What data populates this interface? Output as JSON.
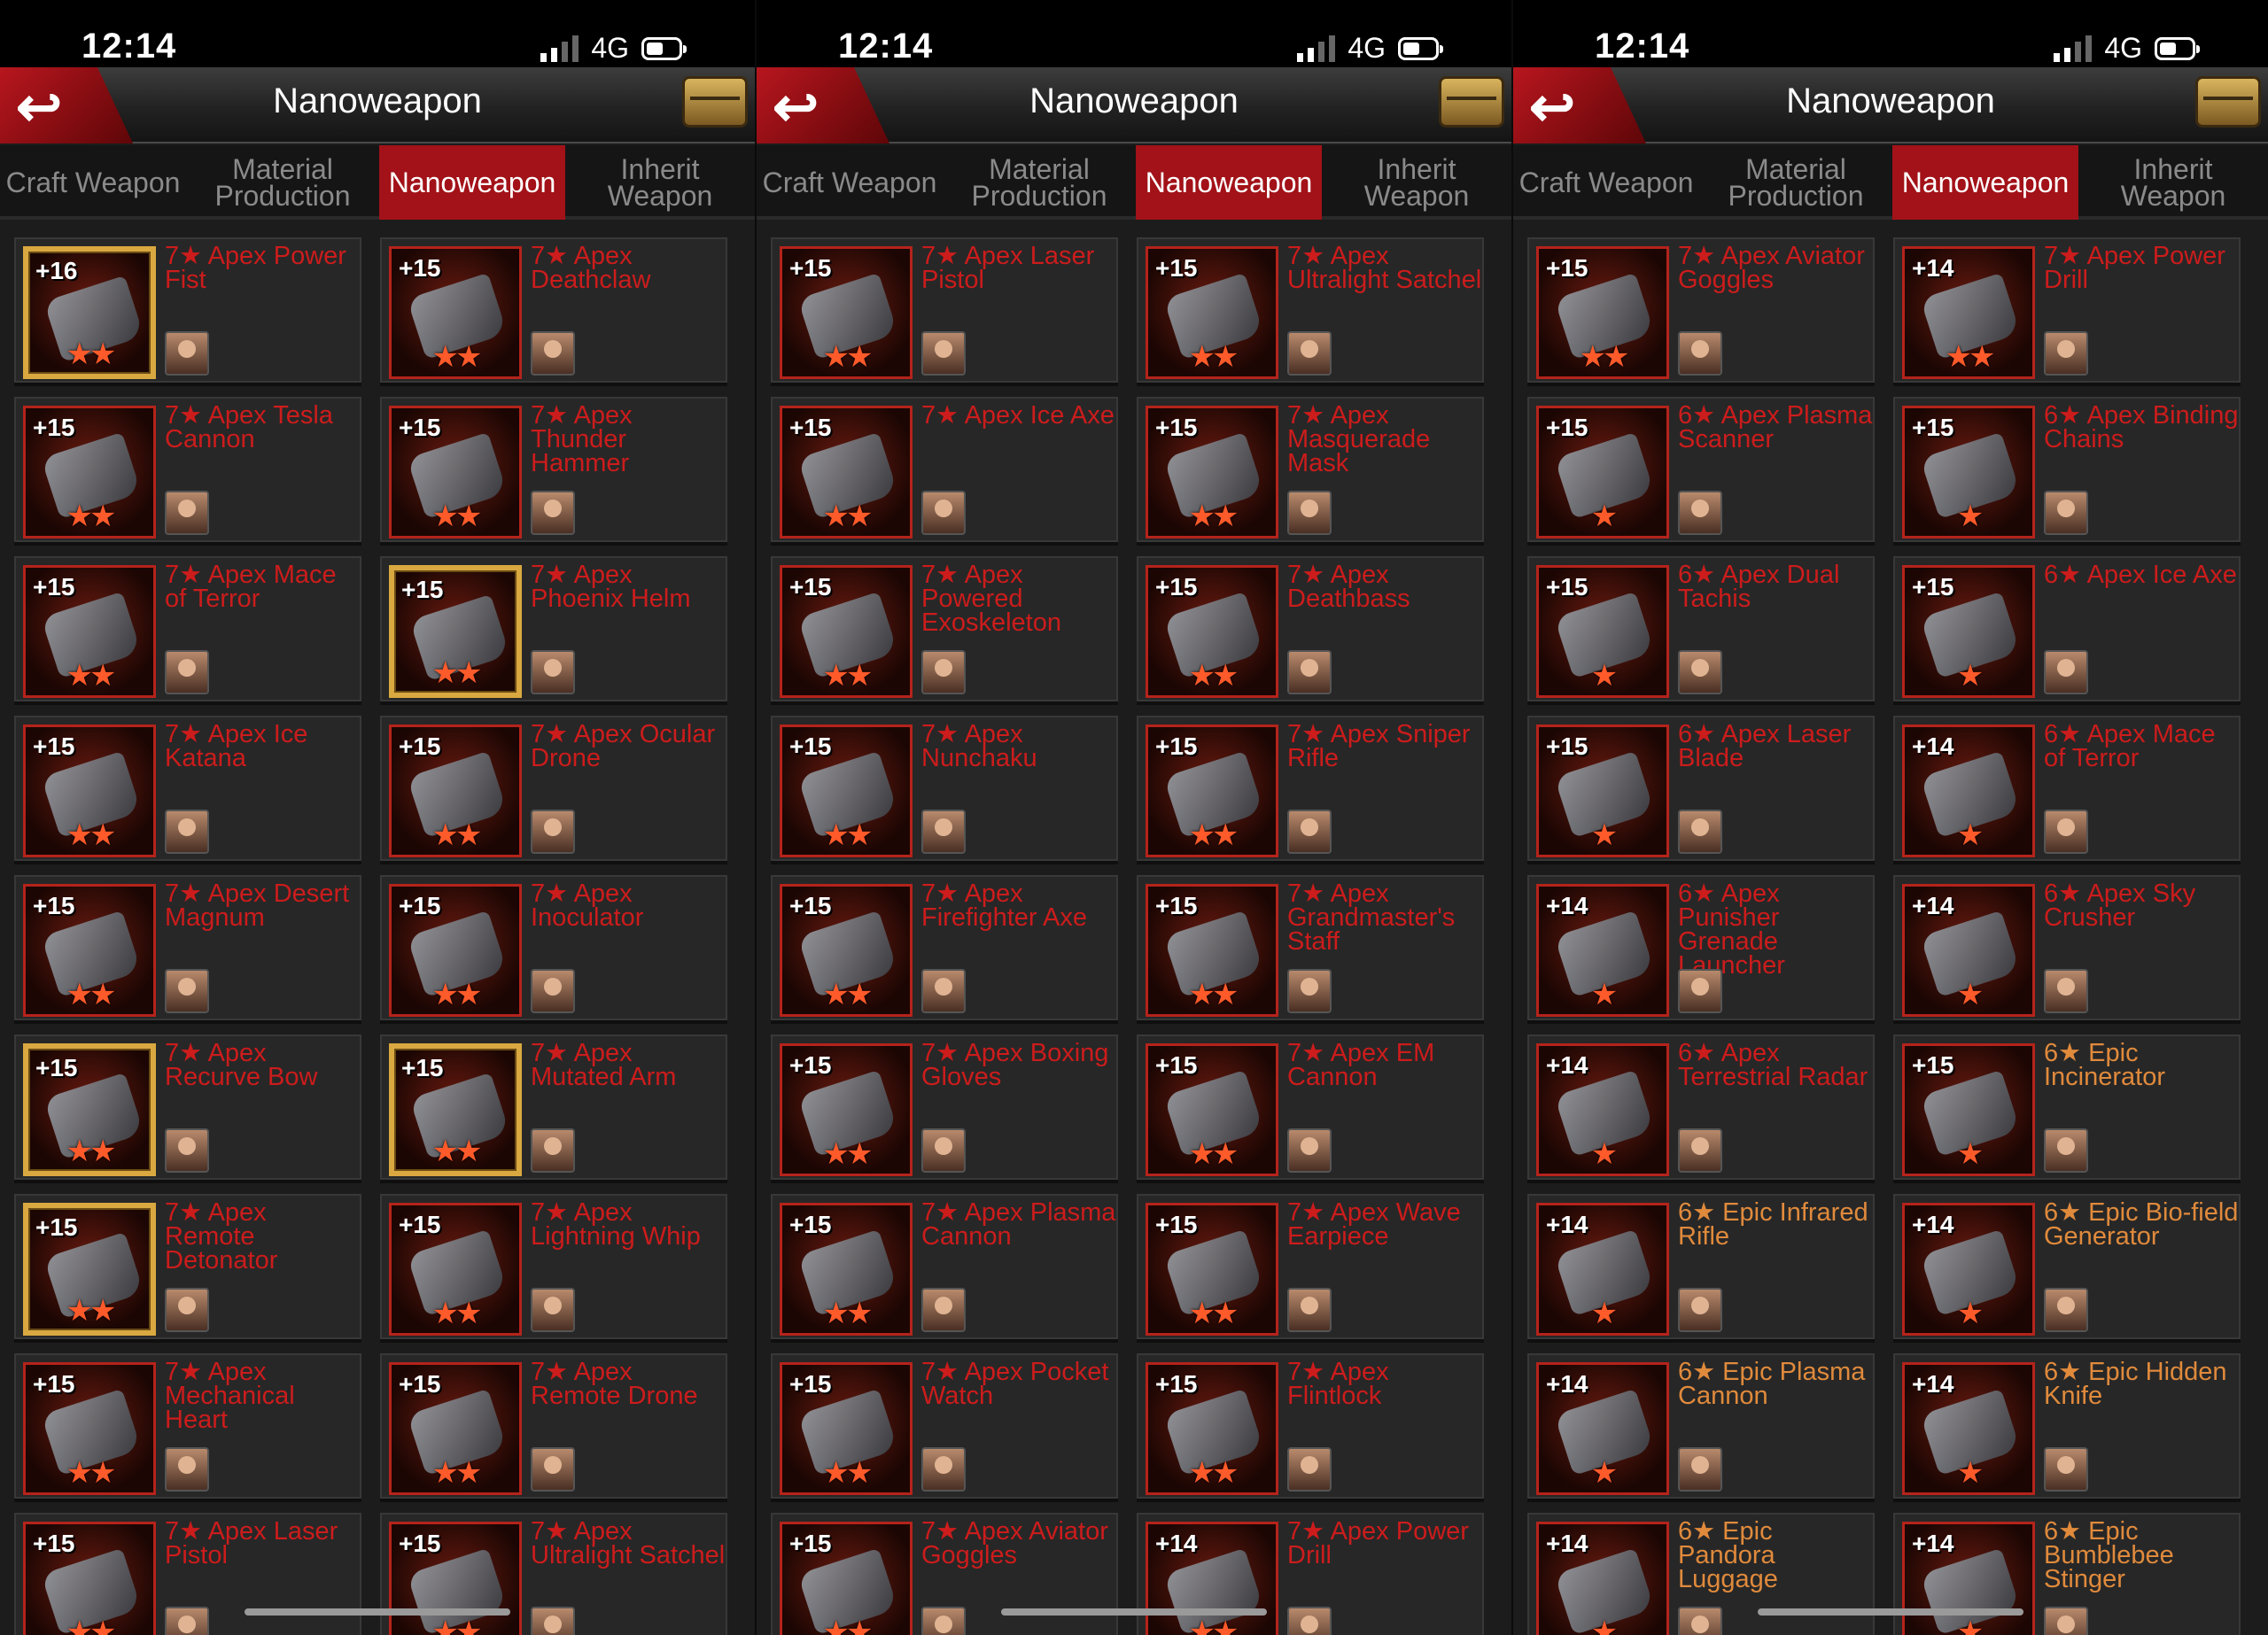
{
  "panels": [
    {
      "status": {
        "time": "12:14",
        "network": "4G"
      },
      "title": "Nanoweapon",
      "tabs": [
        "Craft Weapon",
        "Material Production",
        "Nanoweapon",
        "Inherit Weapon"
      ],
      "active_tab": 2,
      "items": [
        {
          "level": "+16",
          "name": "7★ Apex Power Fist",
          "stars": "★★",
          "gold": true
        },
        {
          "level": "+15",
          "name": "7★ Apex Deathclaw",
          "stars": "★★",
          "gold": false
        },
        {
          "level": "+15",
          "name": "7★ Apex Tesla Cannon",
          "stars": "★★",
          "gold": false
        },
        {
          "level": "+15",
          "name": "7★ Apex Thunder Hammer",
          "stars": "★★",
          "gold": false
        },
        {
          "level": "+15",
          "name": "7★ Apex Mace of Terror",
          "stars": "★★",
          "gold": false
        },
        {
          "level": "+15",
          "name": "7★ Apex Phoenix Helm",
          "stars": "★★",
          "gold": true
        },
        {
          "level": "+15",
          "name": "7★ Apex Ice Katana",
          "stars": "★★",
          "gold": false
        },
        {
          "level": "+15",
          "name": "7★ Apex Ocular Drone",
          "stars": "★★",
          "gold": false
        },
        {
          "level": "+15",
          "name": "7★ Apex Desert Magnum",
          "stars": "★★",
          "gold": false
        },
        {
          "level": "+15",
          "name": "7★ Apex Inoculator",
          "stars": "★★",
          "gold": false
        },
        {
          "level": "+15",
          "name": "7★ Apex Recurve Bow",
          "stars": "★★",
          "gold": true
        },
        {
          "level": "+15",
          "name": "7★ Apex Mutated Arm",
          "stars": "★★",
          "gold": true
        },
        {
          "level": "+15",
          "name": "7★ Apex Remote Detonator",
          "stars": "★★",
          "gold": true
        },
        {
          "level": "+15",
          "name": "7★ Apex Lightning Whip",
          "stars": "★★",
          "gold": false
        },
        {
          "level": "+15",
          "name": "7★ Apex Mechanical Heart",
          "stars": "★★",
          "gold": false
        },
        {
          "level": "+15",
          "name": "7★ Apex Remote Drone",
          "stars": "★★",
          "gold": false
        },
        {
          "level": "+15",
          "name": "7★ Apex Laser Pistol",
          "stars": "★★",
          "gold": false
        },
        {
          "level": "+15",
          "name": "7★ Apex Ultralight Satchel",
          "stars": "★★",
          "gold": false
        }
      ]
    },
    {
      "status": {
        "time": "12:14",
        "network": "4G"
      },
      "title": "Nanoweapon",
      "tabs": [
        "Craft Weapon",
        "Material Production",
        "Nanoweapon",
        "Inherit Weapon"
      ],
      "active_tab": 2,
      "items": [
        {
          "level": "+15",
          "name": "7★ Apex Laser Pistol",
          "stars": "★★",
          "gold": false
        },
        {
          "level": "+15",
          "name": "7★ Apex Ultralight Satchel",
          "stars": "★★",
          "gold": false
        },
        {
          "level": "+15",
          "name": "7★ Apex Ice Axe",
          "stars": "★★",
          "gold": false
        },
        {
          "level": "+15",
          "name": "7★ Apex Masquerade Mask",
          "stars": "★★",
          "gold": false
        },
        {
          "level": "+15",
          "name": "7★ Apex Powered Exoskeleton",
          "stars": "★★",
          "gold": false
        },
        {
          "level": "+15",
          "name": "7★ Apex Deathbass",
          "stars": "★★",
          "gold": false
        },
        {
          "level": "+15",
          "name": "7★ Apex Nunchaku",
          "stars": "★★",
          "gold": false
        },
        {
          "level": "+15",
          "name": "7★ Apex Sniper Rifle",
          "stars": "★★",
          "gold": false
        },
        {
          "level": "+15",
          "name": "7★ Apex Firefighter Axe",
          "stars": "★★",
          "gold": false
        },
        {
          "level": "+15",
          "name": "7★ Apex Grandmaster's Staff",
          "stars": "★★",
          "gold": false
        },
        {
          "level": "+15",
          "name": "7★ Apex Boxing Gloves",
          "stars": "★★",
          "gold": false
        },
        {
          "level": "+15",
          "name": "7★ Apex EM Cannon",
          "stars": "★★",
          "gold": false
        },
        {
          "level": "+15",
          "name": "7★ Apex Plasma Cannon",
          "stars": "★★",
          "gold": false
        },
        {
          "level": "+15",
          "name": "7★ Apex Wave Earpiece",
          "stars": "★★",
          "gold": false
        },
        {
          "level": "+15",
          "name": "7★ Apex Pocket Watch",
          "stars": "★★",
          "gold": false
        },
        {
          "level": "+15",
          "name": "7★ Apex Flintlock",
          "stars": "★★",
          "gold": false
        },
        {
          "level": "+15",
          "name": "7★ Apex Aviator Goggles",
          "stars": "★★",
          "gold": false
        },
        {
          "level": "+14",
          "name": "7★ Apex Power Drill",
          "stars": "★★",
          "gold": false
        }
      ]
    },
    {
      "status": {
        "time": "12:14",
        "network": "4G"
      },
      "title": "Nanoweapon",
      "tabs": [
        "Craft Weapon",
        "Material Production",
        "Nanoweapon",
        "Inherit Weapon"
      ],
      "active_tab": 2,
      "items": [
        {
          "level": "+15",
          "name": "7★ Apex Aviator Goggles",
          "stars": "★★",
          "gold": false
        },
        {
          "level": "+14",
          "name": "7★ Apex Power Drill",
          "stars": "★★",
          "gold": false
        },
        {
          "level": "+15",
          "name": "6★ Apex Plasma Scanner",
          "stars": "★",
          "gold": false
        },
        {
          "level": "+15",
          "name": "6★ Apex Binding Chains",
          "stars": "★",
          "gold": false
        },
        {
          "level": "+15",
          "name": "6★ Apex Dual Tachis",
          "stars": "★",
          "gold": false
        },
        {
          "level": "+15",
          "name": "6★ Apex Ice Axe",
          "stars": "★",
          "gold": false
        },
        {
          "level": "+15",
          "name": "6★ Apex Laser Blade",
          "stars": "★",
          "gold": false
        },
        {
          "level": "+14",
          "name": "6★ Apex Mace of Terror",
          "stars": "★",
          "gold": false
        },
        {
          "level": "+14",
          "name": "6★ Apex Punisher Grenade Launcher",
          "stars": "★",
          "gold": false
        },
        {
          "level": "+14",
          "name": "6★ Apex Sky Crusher",
          "stars": "★",
          "gold": false
        },
        {
          "level": "+14",
          "name": "6★ Apex Terrestrial Radar",
          "stars": "★",
          "gold": false
        },
        {
          "level": "+15",
          "name": "6★ Epic Incinerator",
          "stars": "★",
          "gold": false
        },
        {
          "level": "+14",
          "name": "6★ Epic Infrared Rifle",
          "stars": "★",
          "gold": false
        },
        {
          "level": "+14",
          "name": "6★ Epic Bio-field Generator",
          "stars": "★",
          "gold": false
        },
        {
          "level": "+14",
          "name": "6★ Epic Plasma Cannon",
          "stars": "★",
          "gold": false
        },
        {
          "level": "+14",
          "name": "6★ Epic Hidden Knife",
          "stars": "★",
          "gold": false
        },
        {
          "level": "+14",
          "name": "6★ Epic Pandora Luggage",
          "stars": "★",
          "gold": false
        },
        {
          "level": "+14",
          "name": "6★ Epic Bumblebee Stinger",
          "stars": "★",
          "gold": false
        }
      ]
    }
  ],
  "colors": {
    "accent_red": "#a21218",
    "item_name_red": "#cc1c1c",
    "epic_name_orange": "#e08a3c",
    "gold_frame": "#d9a840"
  }
}
